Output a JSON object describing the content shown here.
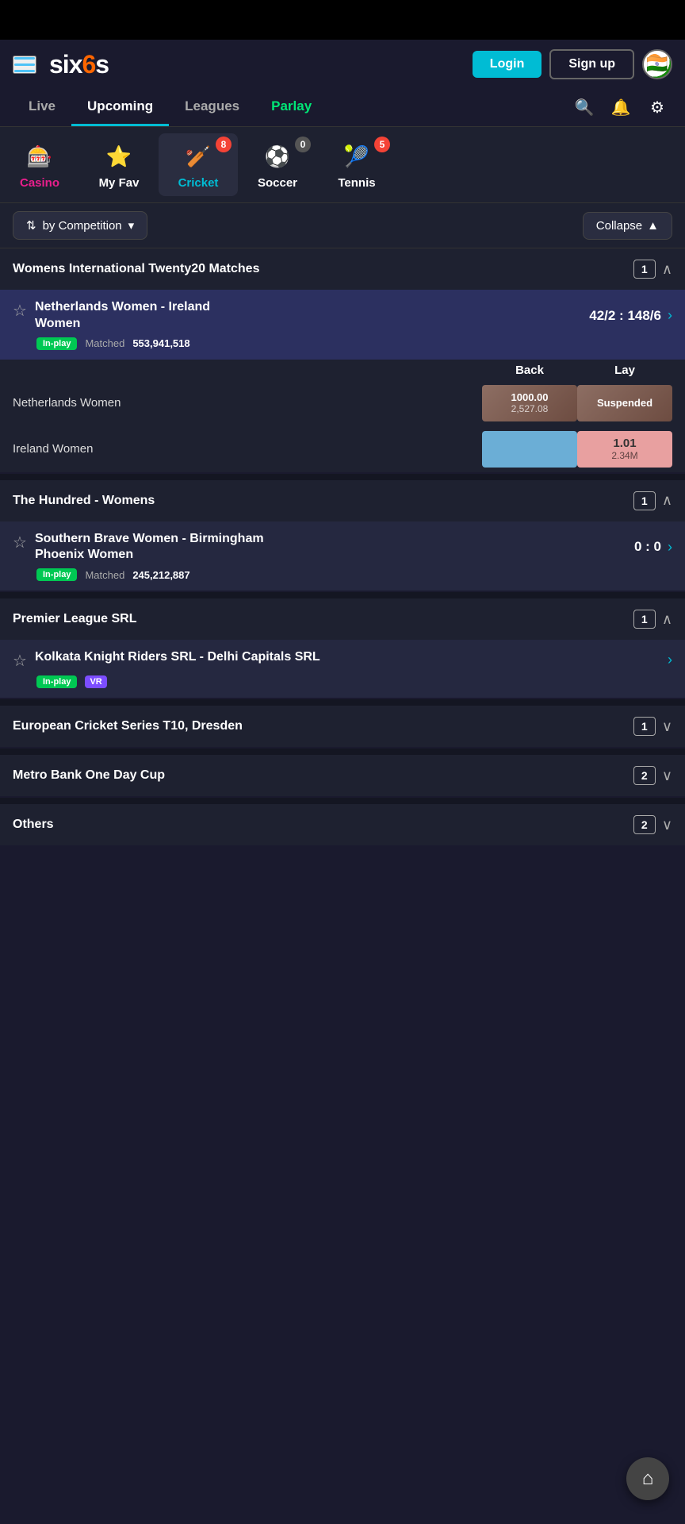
{
  "app": {
    "title": "Six6s",
    "logo": "six6s"
  },
  "statusBar": {
    "height": 50
  },
  "header": {
    "loginLabel": "Login",
    "signupLabel": "Sign up",
    "flagEmoji": "🇮🇳"
  },
  "navTabs": [
    {
      "id": "live",
      "label": "Live",
      "active": false
    },
    {
      "id": "upcoming",
      "label": "Upcoming",
      "active": false
    },
    {
      "id": "leagues",
      "label": "Leagues",
      "active": false
    },
    {
      "id": "parlay",
      "label": "Parlay",
      "active": true,
      "color": "parlay"
    }
  ],
  "sportTabs": [
    {
      "id": "casino",
      "label": "Casino",
      "icon": "🎰",
      "badge": null,
      "active": false,
      "class": "casino"
    },
    {
      "id": "myfav",
      "label": "My Fav",
      "icon": "⭐",
      "badge": null,
      "active": false,
      "class": ""
    },
    {
      "id": "cricket",
      "label": "Cricket",
      "icon": "🏏",
      "badge": "8",
      "active": true,
      "class": "cricket"
    },
    {
      "id": "soccer",
      "label": "Soccer",
      "icon": "⚽",
      "badge": "0",
      "active": false,
      "class": ""
    },
    {
      "id": "tennis",
      "label": "Tennis",
      "icon": "🎾",
      "badge": "5",
      "active": false,
      "class": ""
    }
  ],
  "filterBar": {
    "sortLabel": "by Competition",
    "collapseLabel": "Collapse"
  },
  "competitions": [
    {
      "id": "wt20",
      "title": "Womens International Twenty20 Matches",
      "count": 1,
      "expanded": true,
      "matches": [
        {
          "id": "m1",
          "team1": "Netherlands Women",
          "team2": "Ireland Women",
          "score": "42/2 : 148/6",
          "highlighted": true,
          "inplay": true,
          "matchedLabel": "Matched",
          "matchedAmount": "553,941,518",
          "showOdds": true,
          "odds": [
            {
              "team": "Netherlands Women",
              "back": "1000.00",
              "backSub": "2,527.08",
              "lay": null,
              "laySub": null,
              "suspended": true
            },
            {
              "team": "Ireland Women",
              "back": null,
              "backSub": null,
              "lay": "1.01",
              "laySub": "2.34M",
              "suspended": false
            }
          ]
        }
      ]
    },
    {
      "id": "hundred",
      "title": "The Hundred - Womens",
      "count": 1,
      "expanded": true,
      "matches": [
        {
          "id": "m2",
          "team1": "Southern Brave Women",
          "team2": "Birmingham Phoenix Women",
          "score": "0 : 0",
          "highlighted": false,
          "inplay": true,
          "matchedLabel": "Matched",
          "matchedAmount": "245,212,887",
          "showOdds": false,
          "vr": false
        }
      ]
    },
    {
      "id": "psl",
      "title": "Premier League SRL",
      "count": 1,
      "expanded": true,
      "matches": [
        {
          "id": "m3",
          "team1": "Kolkata Knight Riders SRL",
          "team2": "Delhi Capitals SRL",
          "score": null,
          "highlighted": false,
          "inplay": true,
          "matchedLabel": null,
          "matchedAmount": null,
          "showOdds": false,
          "vr": true
        }
      ]
    },
    {
      "id": "ecs",
      "title": "European Cricket Series T10, Dresden",
      "count": 1,
      "expanded": false,
      "matches": []
    },
    {
      "id": "mboc",
      "title": "Metro Bank One Day Cup",
      "count": 2,
      "expanded": false,
      "matches": []
    },
    {
      "id": "others",
      "title": "Others",
      "count": 2,
      "expanded": false,
      "matches": []
    }
  ],
  "icons": {
    "hamburger": "☰",
    "search": "🔍",
    "bell": "🔔",
    "gear": "⚙",
    "chevronDown": "∨",
    "chevronUp": "∧",
    "arrowRight": "›",
    "home": "⌂",
    "clock": "⏱",
    "sortArrows": "⇅"
  }
}
